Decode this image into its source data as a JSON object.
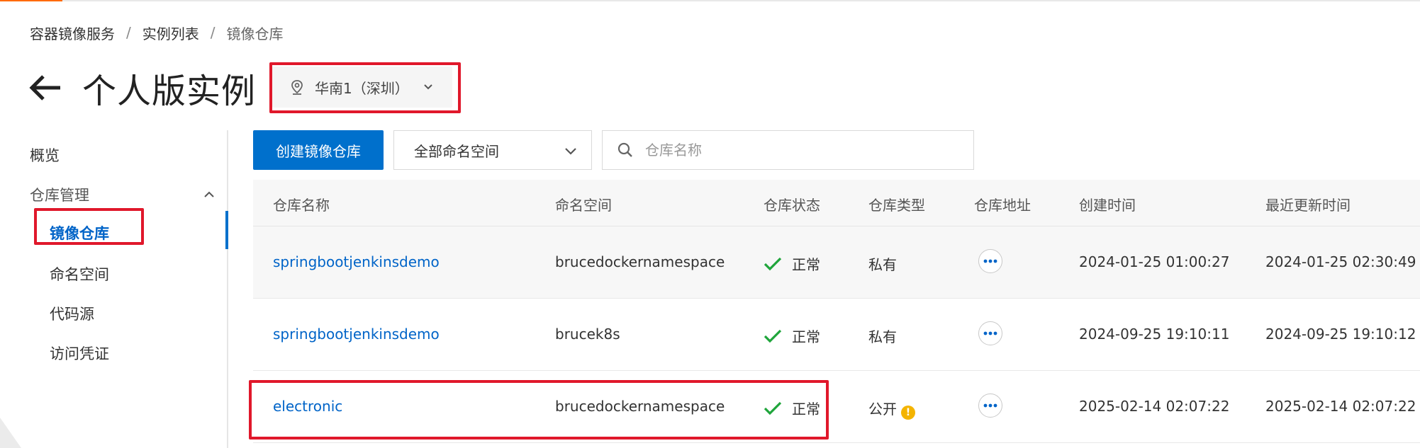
{
  "accent_color": "#0070cc",
  "highlight_color": "#e0182b",
  "breadcrumb": [
    "容器镜像服务",
    "实例列表",
    "镜像仓库"
  ],
  "breadcrumb_separator": "/",
  "page_title": "个人版实例",
  "region_select": {
    "value": "华南1（深圳）",
    "icon": "location-pin-icon"
  },
  "sidebar": {
    "overview": "概览",
    "group": {
      "label": "仓库管理",
      "expanded": true
    },
    "items": [
      {
        "label": "镜像仓库",
        "active": true
      },
      {
        "label": "命名空间",
        "active": false
      },
      {
        "label": "代码源",
        "active": false
      },
      {
        "label": "访问凭证",
        "active": false
      }
    ]
  },
  "toolbar": {
    "create_button": "创建镜像仓库",
    "namespace_filter": "全部命名空间",
    "search_placeholder": "仓库名称"
  },
  "table": {
    "columns": [
      "仓库名称",
      "命名空间",
      "仓库状态",
      "仓库类型",
      "仓库地址",
      "创建时间",
      "最近更新时间"
    ],
    "rows": [
      {
        "name": "springbootjenkinsdemo",
        "namespace": "brucedockernamespace",
        "status": "正常",
        "type": "私有",
        "type_warning": false,
        "created": "2024-01-25 01:00:27",
        "updated": "2024-01-25 02:30:49"
      },
      {
        "name": "springbootjenkinsdemo",
        "namespace": "brucek8s",
        "status": "正常",
        "type": "私有",
        "type_warning": false,
        "created": "2024-09-25 19:10:11",
        "updated": "2024-09-25 19:10:12"
      },
      {
        "name": "electronic",
        "namespace": "brucedockernamespace",
        "status": "正常",
        "type": "公开",
        "type_warning": true,
        "created": "2025-02-14 02:07:22",
        "updated": "2025-02-14 02:07:22"
      }
    ]
  }
}
